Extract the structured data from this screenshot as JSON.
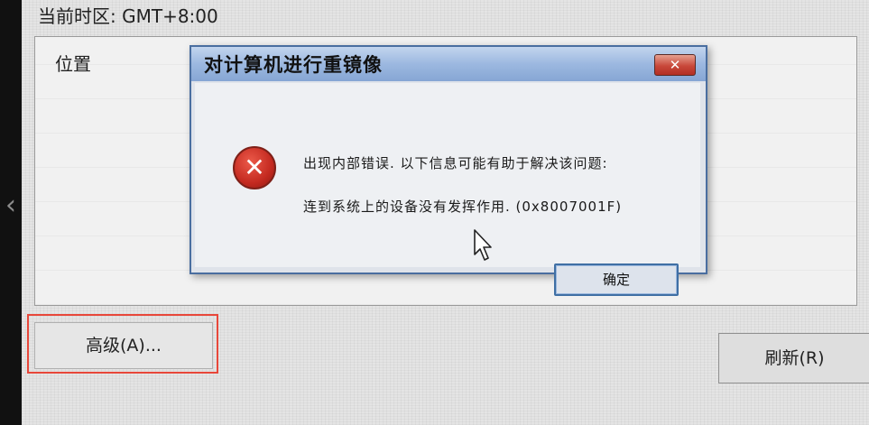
{
  "timezone_label": "当前时区: GMT+8:00",
  "location_panel": {
    "header": "位置"
  },
  "buttons": {
    "advanced": "高级(A)...",
    "refresh": "刷新(R)"
  },
  "dialog": {
    "title": "对计算机进行重镜像",
    "close_icon": "close-icon",
    "error_icon": "error-icon",
    "message": "出现内部错误. 以下信息可能有助于解决该问题:",
    "detail": "连到系统上的设备没有发挥作用. (0x8007001F)",
    "ok_label": "确定"
  },
  "highlight_color": "#e8473a",
  "icons": {
    "left_nav": "chevron-left-icon",
    "pointer": "mouse-cursor-icon"
  }
}
